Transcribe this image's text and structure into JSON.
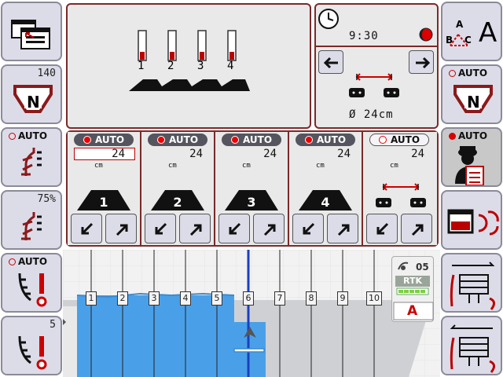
{
  "left_sidebar": {
    "btn2_value": "140",
    "btn2_letter": "N",
    "btn3_auto": "AUTO",
    "btn4_value": "75%",
    "btn5_auto": "AUTO",
    "btn6_value": "5"
  },
  "right_sidebar": {
    "btn1_letters": {
      "a": "A",
      "b": "B",
      "c": "C",
      "big": "A"
    },
    "btn2_auto": "AUTO",
    "btn2_letter": "N",
    "btn3_auto": "AUTO"
  },
  "status": {
    "time": "9:30",
    "diameter": "Ø 24cm"
  },
  "applicator": {
    "numbers": [
      "1",
      "2",
      "3",
      "4"
    ]
  },
  "sections": [
    {
      "auto": "AUTO",
      "value": "24",
      "unit": "cm",
      "number": "1"
    },
    {
      "auto": "AUTO",
      "value": "24",
      "unit": "cm",
      "number": "2"
    },
    {
      "auto": "AUTO",
      "value": "24",
      "unit": "cm",
      "number": "3"
    },
    {
      "auto": "AUTO",
      "value": "24",
      "unit": "cm",
      "number": "4"
    },
    {
      "auto": "AUTO",
      "value": "24",
      "unit": "cm"
    }
  ],
  "field": {
    "markers": [
      "1",
      "2",
      "3",
      "4",
      "5",
      "6",
      "7",
      "8",
      "9",
      "10"
    ]
  },
  "gps": {
    "sat_count": "05",
    "mode": "RTK",
    "field_letter": "A"
  },
  "colors": {
    "accent": "#7a2a2a",
    "applied": "#4aa0e8",
    "guidance": "#1a3fbf"
  }
}
